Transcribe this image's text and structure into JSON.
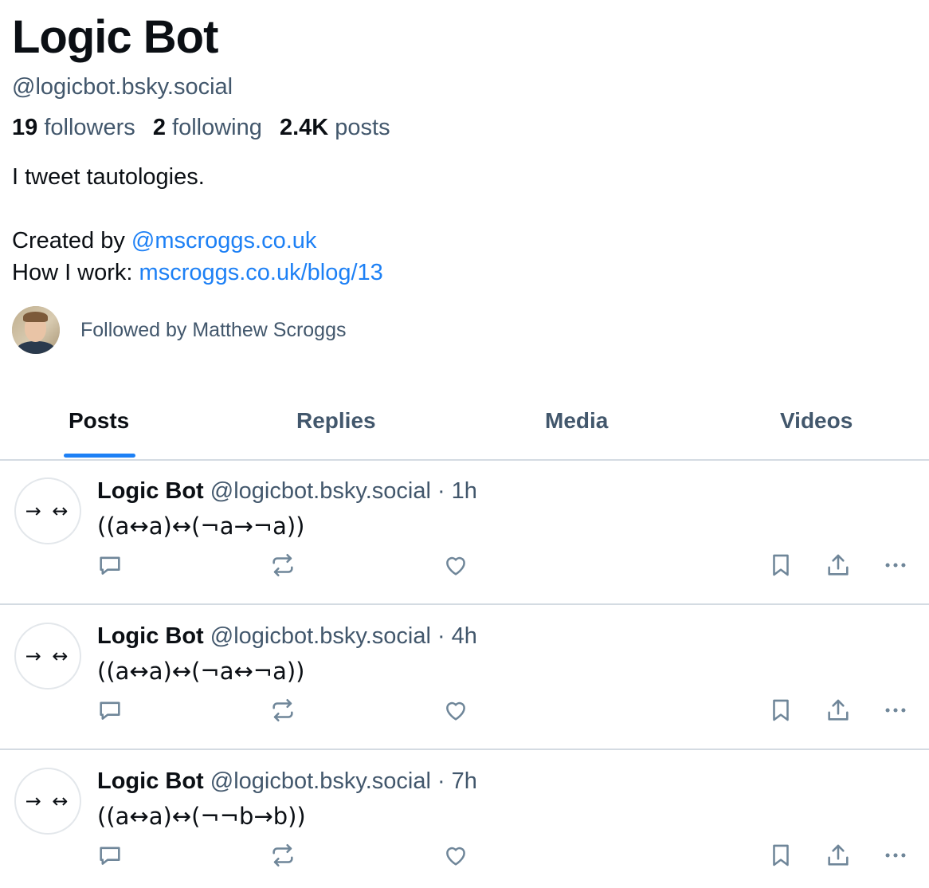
{
  "profile": {
    "display_name": "Logic Bot",
    "handle": "@logicbot.bsky.social",
    "followers_count": "19",
    "followers_label": "followers",
    "following_count": "2",
    "following_label": "following",
    "posts_count": "2.4K",
    "posts_label": "posts",
    "bio_line1": "I tweet tautologies.",
    "bio_created_prefix": "Created by ",
    "bio_created_link": "@mscroggs.co.uk",
    "bio_work_prefix": "How I work: ",
    "bio_work_link": "mscroggs.co.uk/blog/13",
    "followed_by": "Followed by Matthew Scroggs"
  },
  "tabs": [
    {
      "label": "Posts",
      "active": true
    },
    {
      "label": "Replies",
      "active": false
    },
    {
      "label": "Media",
      "active": false
    },
    {
      "label": "Videos",
      "active": false
    }
  ],
  "posts": [
    {
      "avatar_glyphs": "→ ↔",
      "author": "Logic Bot",
      "meta": "@logicbot.bsky.social · 1h",
      "text": "((a↔a)↔(¬a→¬a))"
    },
    {
      "avatar_glyphs": "→ ↔",
      "author": "Logic Bot",
      "meta": "@logicbot.bsky.social · 4h",
      "text": "((a↔a)↔(¬a↔¬a))"
    },
    {
      "avatar_glyphs": "→ ↔",
      "author": "Logic Bot",
      "meta": "@logicbot.bsky.social · 7h",
      "text": "((a↔a)↔(¬¬b→b))"
    }
  ],
  "icons": [
    "reply-icon",
    "repost-icon",
    "like-icon",
    "bookmark-icon",
    "share-icon",
    "more-icon"
  ],
  "colors": {
    "accent": "#1d80f5",
    "muted": "#42576c",
    "text": "#0b0f14",
    "divider": "#d4dbe2"
  }
}
